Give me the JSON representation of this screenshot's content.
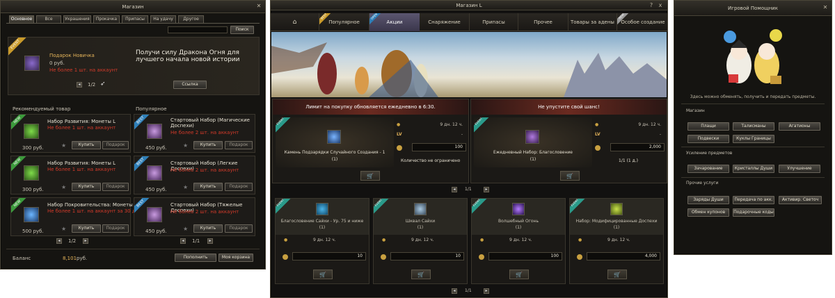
{
  "left": {
    "title": "Магазин",
    "tabs": [
      "Основное",
      "Все",
      "Украшения",
      "Прокачка",
      "Припасы",
      "На удачу",
      "Другое"
    ],
    "search_btn": "Поиск",
    "featured": {
      "badge": "EVENT",
      "name": "Подарок Новичка",
      "price": "0 руб.",
      "limit": "Не более 1 шт. на аккаунт",
      "headline": "Получи силу Дракона Огня для лучшего начала новой истории",
      "link_btn": "Ссылка",
      "pager": "1/2"
    },
    "rec_title": "Рекомендуемый товар",
    "pop_title": "Популярное",
    "rec_items": [
      {
        "badge": "NEW",
        "name": "Набор Развития: Монеты L",
        "limit": "Не более 1 шт. на аккаунт",
        "price": "300 руб.",
        "buy": "Купить",
        "gift": "Подарок"
      },
      {
        "badge": "NEW",
        "name": "Набор Развития: Монеты L",
        "limit": "Не более 1 шт. на аккаунт",
        "price": "300 руб.",
        "buy": "Купить",
        "gift": "Подарок"
      },
      {
        "badge": "NEW",
        "name": "Набор Покровительства: Монеты L",
        "limit": "Не более 1 шт. на аккаунт за 30 дн",
        "price": "500 руб.",
        "buy": "Купить",
        "gift": "Подарок"
      }
    ],
    "pop_items": [
      {
        "badge": "BEST",
        "name": "Стартовый Набор (Магические Доспехи)",
        "limit": "Не более 2 шт. на аккаунт",
        "price": "450 руб.",
        "buy": "Купить",
        "gift": "Подарок"
      },
      {
        "badge": "BEST",
        "name": "Стартовый Набор (Легкие Доспехи)",
        "limit": "Не более 2 шт. на аккаунт",
        "price": "450 руб.",
        "buy": "Купить",
        "gift": "Подарок"
      },
      {
        "badge": "BEST",
        "name": "Стартовый Набор (Тяжелые Доспехи)",
        "limit": "Не более 2 шт. на аккаунт",
        "price": "450 руб.",
        "buy": "Купить",
        "gift": "Подарок"
      }
    ],
    "rec_pager": "1/2",
    "pop_pager": "1/1",
    "balance_label": "Баланс",
    "balance_value": "8,101",
    "balance_unit": "руб.",
    "topup_btn": "Пополнить",
    "cart_btn": "Моя корзина"
  },
  "mid": {
    "title": "Магазин L",
    "help": "?",
    "close": "x",
    "tabs": [
      {
        "label": "",
        "icon": "home-icon"
      },
      {
        "label": "Популярное",
        "badge": "BEST"
      },
      {
        "label": "Акции",
        "badge": "OPEN"
      },
      {
        "label": "Снаряжение"
      },
      {
        "label": "Припасы"
      },
      {
        "label": "Прочее"
      },
      {
        "label": "Товары за адены"
      },
      {
        "label": "Особое создание",
        "badge": "NEW"
      }
    ],
    "big": [
      {
        "header": "Лимит на покупку обновляется ежедневно в 6:30.",
        "badge": "EVENT",
        "name": "Камень Подзарядки Случайного Создания - 1",
        "qty": "(1)",
        "time": "9 дн. 12 ч.",
        "lv": "LV",
        "lv_val": "-",
        "amount": "100",
        "note": "Количество не ограничено"
      },
      {
        "header": "Не упустите свой шанс!",
        "badge": "EVENT",
        "name": "Ежедневный Набор: Благословение",
        "qty": "(1)",
        "time": "9 дн. 12 ч.",
        "lv": "LV",
        "lv_val": "-",
        "amount": "2,000",
        "note": "1/1 (1 д.)"
      }
    ],
    "pager1": "1/1",
    "small": [
      {
        "badge": "EVENT",
        "name": "Благословение Сайхи - Ур. 75 и ниже",
        "qty": "(1)",
        "time": "9 дн. 12 ч.",
        "amount": "10"
      },
      {
        "badge": "EVENT",
        "name": "Шквал Сайхи",
        "qty": "(1)",
        "time": "9 дн. 12 ч.",
        "amount": "10"
      },
      {
        "badge": "EVENT",
        "name": "Волшебный Огонь",
        "qty": "(1)",
        "time": "9 дн. 12 ч.",
        "amount": "100"
      },
      {
        "badge": "EVENT",
        "name": "Набор: Модифицированные Доспехи",
        "qty": "(1)",
        "time": "9 дн. 12 ч.",
        "amount": "4,000"
      }
    ],
    "pager2": "1/1"
  },
  "right": {
    "title": "Игровой Помощник",
    "desc": "Здесь можно обменять, получить и передать предметы.",
    "sections": [
      {
        "title": "Магазин",
        "buttons": [
          "Плащи",
          "Талисманы",
          "Агатионы",
          "Подвески",
          "Куклы Границы"
        ]
      },
      {
        "title": "Усиление предметов",
        "buttons": [
          "Зачарование",
          "Кристаллы Души",
          "Улучшение"
        ]
      },
      {
        "title": "Прочие услуги",
        "buttons": [
          "Заряды Души",
          "Передача по акк.",
          "Активир. Светоч",
          "Обмен купонов",
          "Подарочные коды"
        ]
      }
    ]
  }
}
